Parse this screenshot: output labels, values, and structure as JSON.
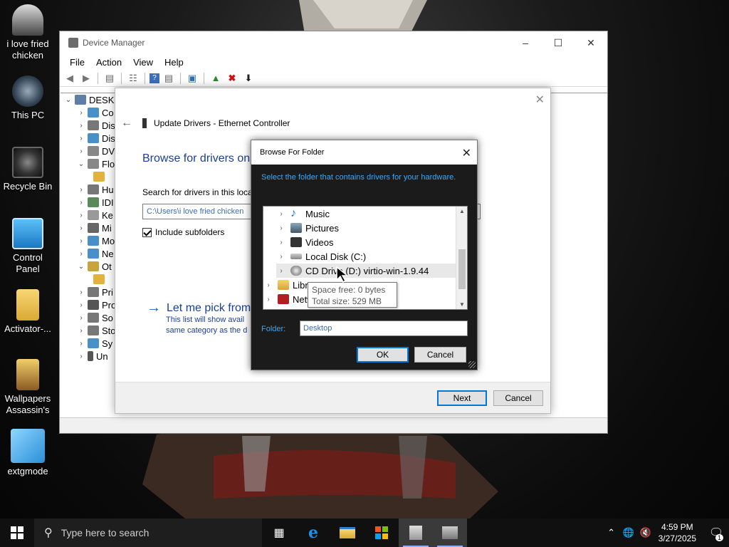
{
  "desktop": {
    "icons": [
      {
        "label": "i love fried chicken",
        "icon": "user-icon"
      },
      {
        "label": "This PC",
        "icon": "computer-icon"
      },
      {
        "label": "Recycle Bin",
        "icon": "recycle-bin-icon"
      },
      {
        "label": "Control Panel",
        "icon": "control-panel-icon"
      },
      {
        "label": "Activator-...",
        "icon": "folder-icon"
      },
      {
        "label": "Wallpapers Assassin's",
        "icon": "folder-icon"
      },
      {
        "label": "extgmode",
        "icon": "app-icon"
      }
    ]
  },
  "device_manager": {
    "title": "Device Manager",
    "menu": [
      "File",
      "Action",
      "View",
      "Help"
    ],
    "tree_root": "DESK",
    "tree_items": [
      "Co",
      "Dis",
      "Dis",
      "DV",
      "Flo",
      "",
      "Hu",
      "IDI",
      "Ke",
      "Mi",
      "Mo",
      "Ne",
      "Ot",
      "",
      "Pri",
      "Pro",
      "So",
      "Sto",
      "Sy",
      "Un"
    ]
  },
  "update_drivers": {
    "window_title": "Update Drivers - Ethernet Controller",
    "heading": "Browse for drivers on",
    "search_label": "Search for drivers in this locat",
    "path_value": "C:\\Users\\i love fried chicken",
    "include_subfolders_label": "Include subfolders",
    "include_subfolders_checked": true,
    "pick_link": "Let me pick from",
    "pick_desc_line1": "This list will show avail",
    "pick_desc_line2": "same category as the d",
    "next_label": "Next",
    "cancel_label": "Cancel"
  },
  "browse_folder": {
    "title": "Browse For Folder",
    "instruction": "Select the folder that contains drivers for your hardware.",
    "items": [
      {
        "label": "Music",
        "icon": "music-icon"
      },
      {
        "label": "Pictures",
        "icon": "pictures-icon"
      },
      {
        "label": "Videos",
        "icon": "videos-icon"
      },
      {
        "label": "Local Disk (C:)",
        "icon": "disk-icon"
      },
      {
        "label": "CD Drive (D:) virtio-win-1.9.44",
        "icon": "cd-drive-icon"
      },
      {
        "label": "Libra",
        "icon": "library-icon"
      },
      {
        "label": "Netw",
        "icon": "network-icon"
      }
    ],
    "tooltip_line1": "Space free: 0 bytes",
    "tooltip_line2": "Total size: 529 MB",
    "folder_label": "Folder:",
    "folder_value": "Desktop",
    "ok_label": "OK",
    "cancel_label": "Cancel"
  },
  "taskbar": {
    "search_placeholder": "Type here to search",
    "time": "4:59 PM",
    "date": "3/27/2025",
    "notification_count": "1"
  },
  "colors": {
    "dialog_link_blue": "#1a3e9a",
    "instruction_blue": "#3da7f5",
    "primary_button_border": "#0078d7",
    "taskbar_bg": "#101010"
  }
}
